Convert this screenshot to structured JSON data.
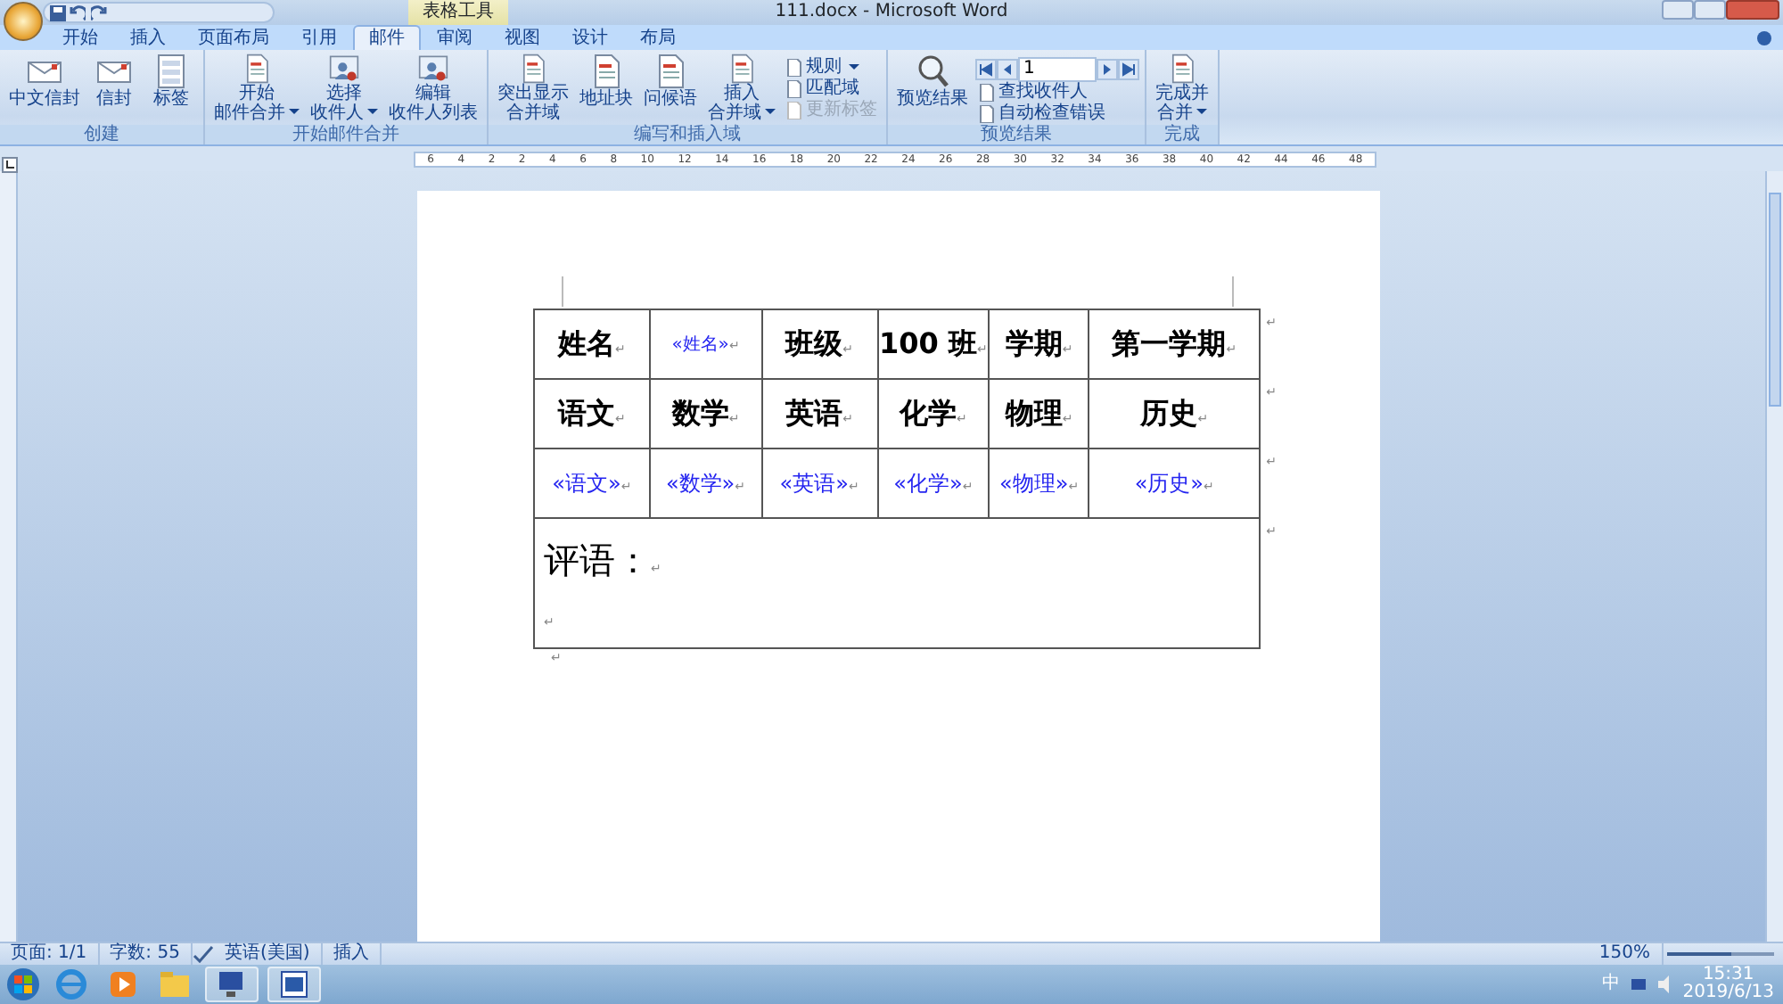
{
  "window": {
    "title": "111.docx - Microsoft Word"
  },
  "contextual_tab_group": "表格工具",
  "tabs": [
    {
      "label": "开始",
      "selected": false
    },
    {
      "label": "插入",
      "selected": false
    },
    {
      "label": "页面布局",
      "selected": false
    },
    {
      "label": "引用",
      "selected": false
    },
    {
      "label": "邮件",
      "selected": true
    },
    {
      "label": "审阅",
      "selected": false
    },
    {
      "label": "视图",
      "selected": false
    },
    {
      "label": "设计",
      "selected": false
    },
    {
      "label": "布局",
      "selected": false
    }
  ],
  "ribbon_groups": [
    {
      "title": "创建",
      "items": [
        {
          "kind": "large",
          "lines": [
            "中文信封"
          ],
          "dropdown": false
        },
        {
          "kind": "large",
          "lines": [
            "信封"
          ],
          "dropdown": false
        },
        {
          "kind": "large",
          "lines": [
            "标签"
          ],
          "dropdown": false
        }
      ]
    },
    {
      "title": "开始邮件合并",
      "items": [
        {
          "kind": "large",
          "lines": [
            "开始",
            "邮件合并"
          ],
          "dropdown": true
        },
        {
          "kind": "large",
          "lines": [
            "选择",
            "收件人"
          ],
          "dropdown": true
        },
        {
          "kind": "large",
          "lines": [
            "编辑",
            "收件人列表"
          ],
          "dropdown": false
        }
      ]
    },
    {
      "title": "编写和插入域",
      "items": [
        {
          "kind": "large",
          "lines": [
            "突出显示",
            "合并域"
          ],
          "dropdown": false
        },
        {
          "kind": "large",
          "lines": [
            "地址块"
          ],
          "dropdown": false
        },
        {
          "kind": "large",
          "lines": [
            "问候语"
          ],
          "dropdown": false
        },
        {
          "kind": "large",
          "lines": [
            "插入",
            "合并域"
          ],
          "dropdown": true
        },
        {
          "kind": "stack",
          "items": [
            {
              "label": "规则",
              "dropdown": true,
              "disabled": false
            },
            {
              "label": "匹配域",
              "dropdown": false,
              "disabled": false
            },
            {
              "label": "更新标签",
              "dropdown": false,
              "disabled": true
            }
          ]
        }
      ]
    },
    {
      "title": "预览结果",
      "items": [
        {
          "kind": "large",
          "lines": [
            "预览结果"
          ],
          "dropdown": false
        },
        {
          "kind": "nav",
          "value": "1",
          "items": [
            {
              "label": "查找收件人",
              "dropdown": false,
              "disabled": false
            },
            {
              "label": "自动检查错误",
              "dropdown": false,
              "disabled": false
            }
          ]
        }
      ]
    },
    {
      "title": "完成",
      "items": [
        {
          "kind": "large",
          "lines": [
            "完成并",
            "合并"
          ],
          "dropdown": true
        }
      ]
    }
  ],
  "ruler": {
    "labels": [
      "6",
      "4",
      "2",
      "2",
      "4",
      "6",
      "8",
      "10",
      "12",
      "14",
      "16",
      "18",
      "20",
      "22",
      "24",
      "26",
      "28",
      "30",
      "32",
      "34",
      "36",
      "38",
      "40",
      "42",
      "44",
      "46",
      "48"
    ]
  },
  "document": {
    "paragraph_mark": "↵",
    "table": {
      "rows": [
        [
          {
            "text": "姓名",
            "kind": "label"
          },
          {
            "text": "«姓名»",
            "kind": "small_field"
          },
          {
            "text": "班级",
            "kind": "label"
          },
          {
            "text": "100 班",
            "kind": "label"
          },
          {
            "text": "学期",
            "kind": "label"
          },
          {
            "text": "第一学期",
            "kind": "label"
          }
        ],
        [
          {
            "text": "语文",
            "kind": "label"
          },
          {
            "text": "数学",
            "kind": "label"
          },
          {
            "text": "英语",
            "kind": "label"
          },
          {
            "text": "化学",
            "kind": "label"
          },
          {
            "text": "物理",
            "kind": "label"
          },
          {
            "text": "历史",
            "kind": "label"
          }
        ],
        [
          {
            "text": "«语文»",
            "kind": "field"
          },
          {
            "text": "«数学»",
            "kind": "field"
          },
          {
            "text": "«英语»",
            "kind": "field"
          },
          {
            "text": "«化学»",
            "kind": "field"
          },
          {
            "text": "«物理»",
            "kind": "field"
          },
          {
            "text": "«历史»",
            "kind": "field"
          }
        ]
      ],
      "comment": "评语："
    }
  },
  "status_bar": {
    "items": [
      "页面: 1/1",
      "字数: 55",
      "英语(美国)",
      "插入"
    ],
    "zoom": "150%",
    "zoom_slider": {
      "level": 0.6
    }
  },
  "taskbar": {
    "ime": "中",
    "time": "15:31",
    "date": "2019/6/13"
  }
}
